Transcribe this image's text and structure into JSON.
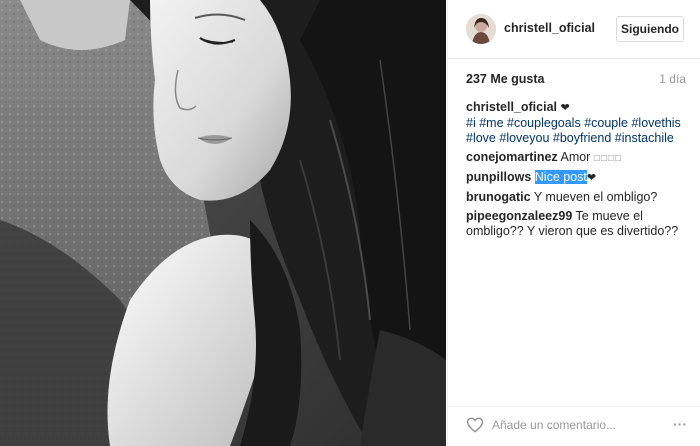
{
  "post": {
    "username": "christell_oficial",
    "follow_label": "Siguiendo",
    "likes": "237 Me gusta",
    "time": "1 día",
    "caption": {
      "user": "christell_oficial",
      "heart": "❤",
      "hashtags": [
        "#i",
        "#me",
        "#couplegoals",
        "#couple",
        "#lovethis",
        "#love",
        "#loveyou",
        "#boyfriend",
        "#instachile"
      ]
    },
    "comments": [
      {
        "user": "conejomartinez",
        "text": "Amor",
        "extra": "□□□□"
      },
      {
        "user": "punpillows",
        "highlight": "Nice post",
        "extra": "❤"
      },
      {
        "user": "brunogatic",
        "text": "Y mueven el ombligo?"
      },
      {
        "user": "pipeegonzaleez99",
        "text": "Te mueve el ombligo?? Y vieron que es divertido??"
      }
    ],
    "comment_placeholder": "Añade un comentario...",
    "more_label": "···"
  },
  "icons": {
    "like": "heart-outline-icon",
    "more": "more-options-icon"
  },
  "colors": {
    "text": "#262626",
    "muted": "#999999",
    "hashtag": "#003569",
    "selection": "#3399ff",
    "border": "#efefef"
  }
}
